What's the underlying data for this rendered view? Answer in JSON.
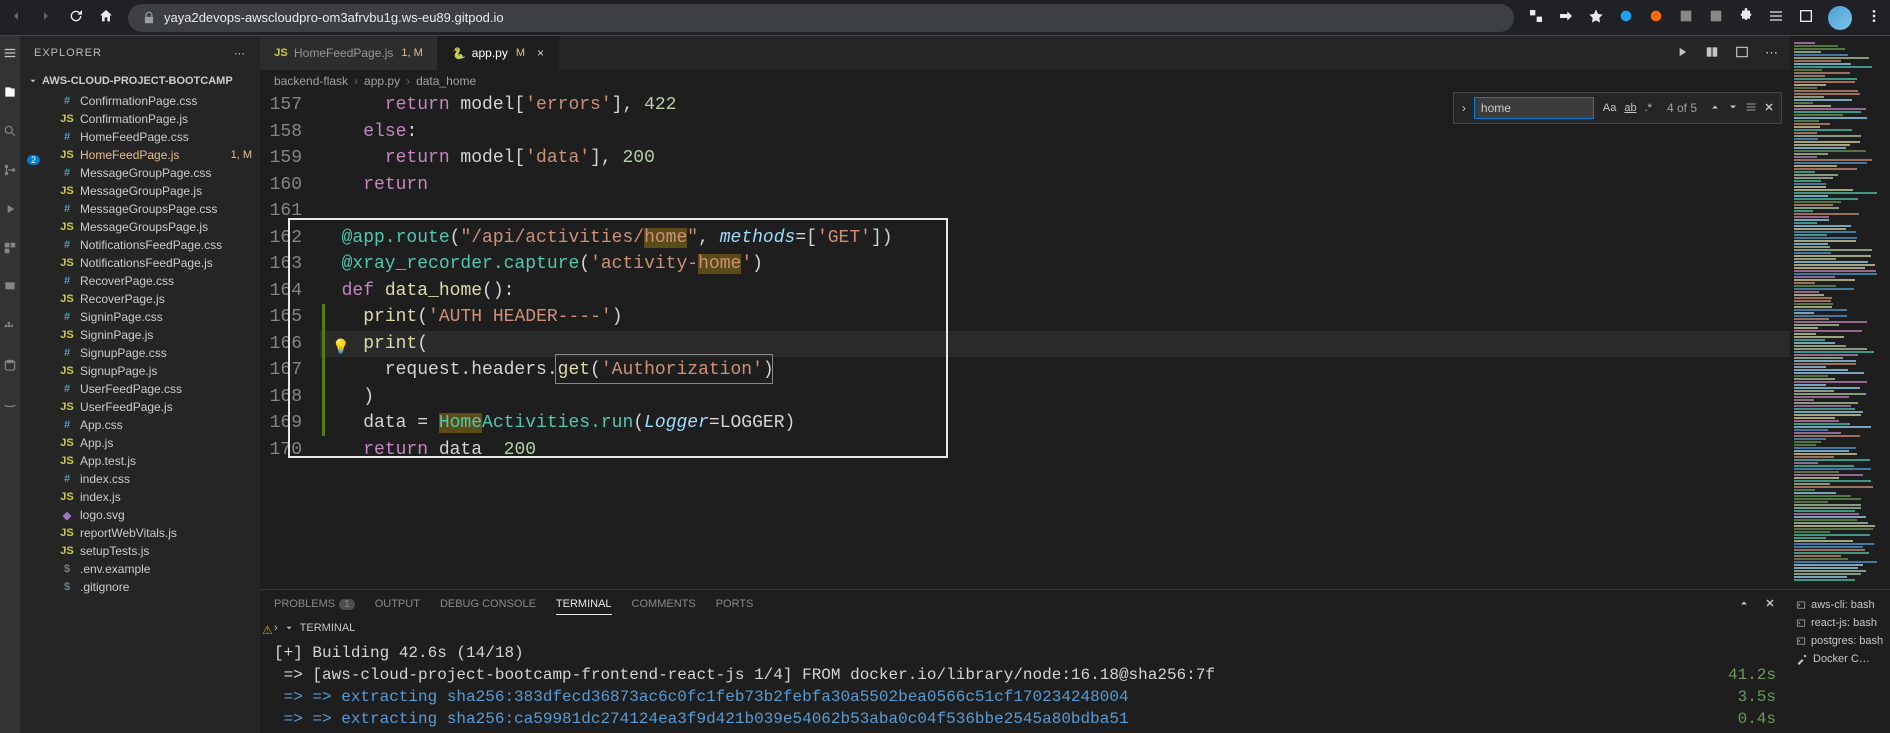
{
  "browser": {
    "url": "yaya2devops-awscloudpro-om3afrvbu1g.ws-eu89.gitpod.io"
  },
  "explorer": {
    "title": "EXPLORER",
    "project": "AWS-CLOUD-PROJECT-BOOTCAMP",
    "files": [
      {
        "name": "ConfirmationPage.css",
        "icon": "css"
      },
      {
        "name": "ConfirmationPage.js",
        "icon": "js"
      },
      {
        "name": "HomeFeedPage.css",
        "icon": "css"
      },
      {
        "name": "HomeFeedPage.js",
        "icon": "js",
        "active": true,
        "status": "1, M"
      },
      {
        "name": "MessageGroupPage.css",
        "icon": "css"
      },
      {
        "name": "MessageGroupPage.js",
        "icon": "js"
      },
      {
        "name": "MessageGroupsPage.css",
        "icon": "css"
      },
      {
        "name": "MessageGroupsPage.js",
        "icon": "js"
      },
      {
        "name": "NotificationsFeedPage.css",
        "icon": "css"
      },
      {
        "name": "NotificationsFeedPage.js",
        "icon": "js"
      },
      {
        "name": "RecoverPage.css",
        "icon": "css"
      },
      {
        "name": "RecoverPage.js",
        "icon": "js"
      },
      {
        "name": "SigninPage.css",
        "icon": "css"
      },
      {
        "name": "SigninPage.js",
        "icon": "js"
      },
      {
        "name": "SignupPage.css",
        "icon": "css"
      },
      {
        "name": "SignupPage.js",
        "icon": "js"
      },
      {
        "name": "UserFeedPage.css",
        "icon": "css"
      },
      {
        "name": "UserFeedPage.js",
        "icon": "js"
      },
      {
        "name": "App.css",
        "icon": "css"
      },
      {
        "name": "App.js",
        "icon": "js"
      },
      {
        "name": "App.test.js",
        "icon": "js"
      },
      {
        "name": "index.css",
        "icon": "css"
      },
      {
        "name": "index.js",
        "icon": "js"
      },
      {
        "name": "logo.svg",
        "icon": "svg"
      },
      {
        "name": "reportWebVitals.js",
        "icon": "js"
      },
      {
        "name": "setupTests.js",
        "icon": "js"
      },
      {
        "name": ".env.example",
        "icon": "dot"
      },
      {
        "name": ".gitignore",
        "icon": "dot"
      }
    ]
  },
  "tabs": [
    {
      "label": "HomeFeedPage.js",
      "icon": "js",
      "status": "1, M",
      "active": false
    },
    {
      "label": "app.py",
      "icon": "py",
      "status": "M",
      "active": true,
      "close": true
    }
  ],
  "breadcrumbs": [
    "backend-flask",
    "app.py",
    "data_home"
  ],
  "find": {
    "value": "home",
    "count": "4 of 5"
  },
  "code": {
    "start": 157,
    "lines": [
      {
        "raw": "      return model['errors'], 422",
        "tokens": [
          [
            "      ",
            "op"
          ],
          [
            "return",
            "kw"
          ],
          [
            " model[",
            "op"
          ],
          [
            "'errors'",
            "str"
          ],
          [
            "], ",
            "op"
          ],
          [
            "422",
            "num"
          ]
        ]
      },
      {
        "raw": "    else:",
        "tokens": [
          [
            "    ",
            "op"
          ],
          [
            "else",
            "kw"
          ],
          [
            ":",
            "op"
          ]
        ]
      },
      {
        "raw": "      return model['data'], 200",
        "tokens": [
          [
            "      ",
            "op"
          ],
          [
            "return",
            "kw"
          ],
          [
            " model[",
            "op"
          ],
          [
            "'data'",
            "str"
          ],
          [
            "], ",
            "op"
          ],
          [
            "200",
            "num"
          ]
        ]
      },
      {
        "raw": "    return",
        "tokens": [
          [
            "    ",
            "op"
          ],
          [
            "return",
            "kw"
          ]
        ]
      },
      {
        "raw": "",
        "tokens": []
      },
      {
        "raw": "  @app.route(\"/api/activities/home\", methods=['GET'])",
        "tokens": [
          [
            "  @app.route",
            "dec"
          ],
          [
            "(",
            "op"
          ],
          [
            "\"/api/activities/",
            "str"
          ],
          [
            "home",
            "str match"
          ],
          [
            "\"",
            "str"
          ],
          [
            ", ",
            "op"
          ],
          [
            "methods",
            "var italic"
          ],
          [
            "=[",
            "op"
          ],
          [
            "'GET'",
            "str"
          ],
          [
            "])",
            "op"
          ]
        ]
      },
      {
        "raw": "  @xray_recorder.capture('activity-home')",
        "tokens": [
          [
            "  @xray_recorder.capture",
            "dec"
          ],
          [
            "(",
            "op"
          ],
          [
            "'activity-",
            "str"
          ],
          [
            "home",
            "str match"
          ],
          [
            "'",
            "str"
          ],
          [
            ")",
            "op"
          ]
        ]
      },
      {
        "raw": "  def data_home():",
        "tokens": [
          [
            "  ",
            "op"
          ],
          [
            "def",
            "kw"
          ],
          [
            " ",
            "op"
          ],
          [
            "data_home",
            "fn"
          ],
          [
            "():",
            "op"
          ]
        ]
      },
      {
        "raw": "    print('AUTH HEADER----')",
        "tokens": [
          [
            "    ",
            "op"
          ],
          [
            "print",
            "fn"
          ],
          [
            "(",
            "op"
          ],
          [
            "'AUTH HEADER----'",
            "str"
          ],
          [
            ")",
            "op"
          ]
        ]
      },
      {
        "raw": "    print(",
        "tokens": [
          [
            "    ",
            "op"
          ],
          [
            "print",
            "fn"
          ],
          [
            "(",
            "op"
          ]
        ],
        "current": true
      },
      {
        "raw": "      request.headers.get('Authorization')",
        "tokens": [
          [
            "      request.headers.",
            "op"
          ],
          [
            "get",
            "fn"
          ],
          [
            "(",
            "op"
          ],
          [
            "'Authorization'",
            "str"
          ],
          [
            ")",
            "op"
          ]
        ]
      },
      {
        "raw": "    )",
        "tokens": [
          [
            "    )",
            "op"
          ]
        ]
      },
      {
        "raw": "    data = HomeActivities.run(Logger=LOGGER)",
        "tokens": [
          [
            "    data = ",
            "op"
          ],
          [
            "Home",
            "dec match"
          ],
          [
            "Activities.run",
            "dec"
          ],
          [
            "(",
            "op"
          ],
          [
            "Logger",
            "var italic"
          ],
          [
            "=LOGGER)",
            "op"
          ]
        ]
      },
      {
        "raw": "    return data  200",
        "tokens": [
          [
            "    ",
            "op"
          ],
          [
            "return",
            "kw"
          ],
          [
            " data  ",
            "op"
          ],
          [
            "200",
            "num"
          ]
        ]
      }
    ]
  },
  "panel": {
    "tabs": {
      "problems": "PROBLEMS",
      "problems_count": "1",
      "output": "OUTPUT",
      "debug": "DEBUG CONSOLE",
      "terminal": "TERMINAL",
      "comments": "COMMENTS",
      "ports": "PORTS"
    },
    "terminal_label": "TERMINAL",
    "terminal_lines": [
      {
        "left": "[+] Building 42.6s (14/18)",
        "right": ""
      },
      {
        "left": " => [aws-cloud-project-bootcamp-frontend-react-js 1/4] FROM docker.io/library/node:16.18@sha256:7f",
        "right": "41.2s"
      },
      {
        "left": " => => extracting sha256:383dfecd36873ac6c0fc1feb73b2febfa30a5502bea0566c51cf170234248004",
        "right": "3.5s",
        "blue": true
      },
      {
        "left": " => => extracting sha256:ca59981dc274124ea3f9d421b039e54062b53aba0c04f536bbe2545a80bdba51",
        "right": "0.4s",
        "blue": true
      }
    ],
    "terminals": [
      {
        "label": "aws-cli: bash"
      },
      {
        "label": "react-js: bash"
      },
      {
        "label": "postgres: bash"
      }
    ],
    "docker": "Docker C…"
  }
}
